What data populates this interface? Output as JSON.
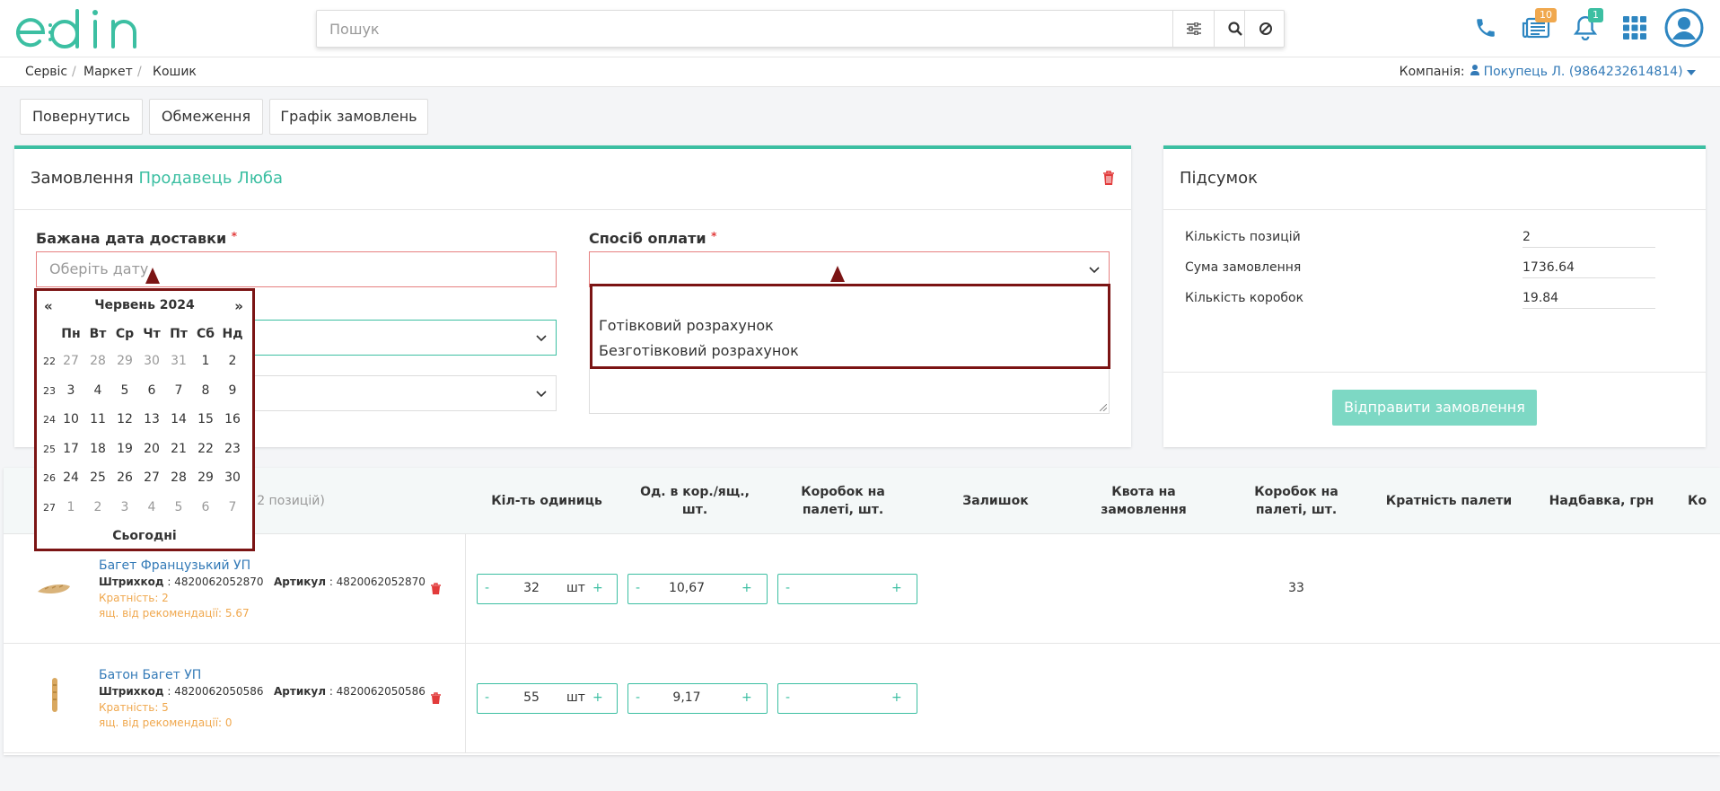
{
  "header": {
    "search_placeholder": "Пошук",
    "badges": {
      "docs": "10",
      "notifications": "1"
    }
  },
  "breadcrumb": [
    "Сервіс",
    "Маркет",
    "Кошик"
  ],
  "company": {
    "label": "Компанія:",
    "value": "Покупець Л. (9864232614814)"
  },
  "toolbar": {
    "back": "Повернутись",
    "limits": "Обмеження",
    "schedule": "Графік замовлень"
  },
  "order": {
    "title_prefix": "Замовлення",
    "seller": "Продавець Люба",
    "delivery_label": "Бажана дата доставки",
    "delivery_placeholder": "Оберіть дату",
    "payment_label": "Спосіб оплати",
    "required": "*"
  },
  "calendar": {
    "prev": "«",
    "next": "»",
    "month": "Червень 2024",
    "days": [
      "Пн",
      "Вт",
      "Ср",
      "Чт",
      "Пт",
      "Сб",
      "Нд"
    ],
    "weeks": [
      {
        "n": "22",
        "d": [
          "27",
          "28",
          "29",
          "30",
          "31",
          "1",
          "2"
        ]
      },
      {
        "n": "23",
        "d": [
          "3",
          "4",
          "5",
          "6",
          "7",
          "8",
          "9"
        ]
      },
      {
        "n": "24",
        "d": [
          "10",
          "11",
          "12",
          "13",
          "14",
          "15",
          "16"
        ]
      },
      {
        "n": "25",
        "d": [
          "17",
          "18",
          "19",
          "20",
          "21",
          "22",
          "23"
        ]
      },
      {
        "n": "26",
        "d": [
          "24",
          "25",
          "26",
          "27",
          "28",
          "29",
          "30"
        ]
      },
      {
        "n": "27",
        "d": [
          "1",
          "2",
          "3",
          "4",
          "5",
          "6",
          "7"
        ]
      }
    ],
    "today": "Сьогодні"
  },
  "payment_options": [
    "Готівковий розрахунок",
    "Безготівковий розрахунок"
  ],
  "summary": {
    "title": "Підсумок",
    "rows": [
      {
        "label": "Кількість позицій",
        "value": "2"
      },
      {
        "label": "Сума замовлення",
        "value": "1736.64"
      },
      {
        "label": "Кількість коробок",
        "value": "19.84"
      }
    ],
    "send": "Відправити замовлення"
  },
  "table": {
    "partial_header": "2 позицій)",
    "headers": [
      "Кіл-ть одиниць",
      "Од. в кор./ящ., шт.",
      "Коробок на палеті, шт.",
      "Залишок",
      "Квота на замовлення",
      "Коробок на палеті, шт.",
      "Кратність палети",
      "Надбавка, грн",
      "Ко"
    ],
    "rows": [
      {
        "name": "Багет Французький УП",
        "barcode_label": "Штрихкод",
        "barcode": "4820062052870",
        "article_label": "Артикул",
        "article": "4820062052870",
        "multiplicity": "Кратність:  2",
        "recommend": "ящ. від рекомендації:  5.67",
        "qty": "32",
        "unit": "шт",
        "per_box": "10,67",
        "pallet_boxes": "",
        "pallet_boxes2": "33"
      },
      {
        "name": "Батон Багет УП",
        "barcode_label": "Штрихкод",
        "barcode": "4820062050586",
        "article_label": "Артикул",
        "article": "4820062050586",
        "multiplicity": "Кратність:  5",
        "recommend": "ящ. від рекомендації:  0",
        "qty": "55",
        "unit": "шт",
        "per_box": "9,17",
        "pallet_boxes": "",
        "pallet_boxes2": ""
      }
    ],
    "minus": "-",
    "plus": "+"
  },
  "colors": {
    "accent": "#3cbfa2",
    "link": "#337ab7",
    "warning": "#f0a84e",
    "highlight": "#7b1414",
    "danger": "#e23b3b"
  }
}
